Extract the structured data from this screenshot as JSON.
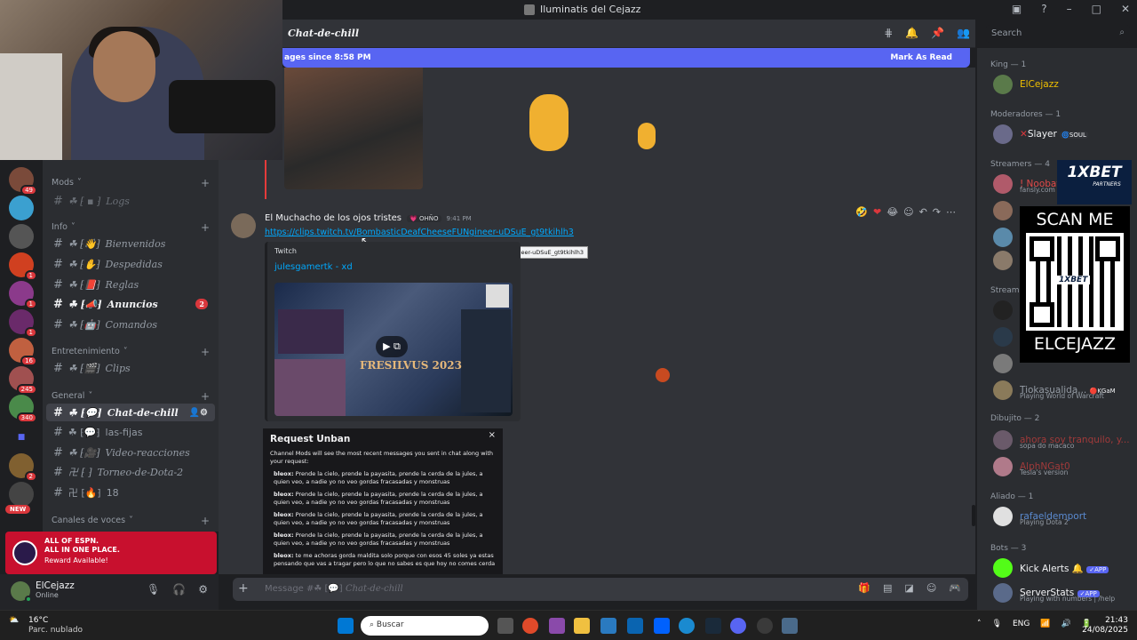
{
  "window": {
    "title": "Iluminatis del Cejazz"
  },
  "header": {
    "channel": "Chat-de-chill",
    "search_placeholder": "Search"
  },
  "new_messages": {
    "text": "ages since 8:58 PM",
    "mark_read": "Mark As Read"
  },
  "servers": {
    "badges": [
      "49",
      "1",
      "1",
      "1",
      "16",
      "245",
      "340",
      "2",
      "NEW"
    ]
  },
  "channels": {
    "categories": {
      "mods": "Mods",
      "info": "Info",
      "entretenimiento": "Entretenimiento",
      "general": "General",
      "voces": "Canales de voces"
    },
    "items": [
      {
        "label": "Logs"
      },
      {
        "label": "Bienvenidos"
      },
      {
        "label": "Despedidas"
      },
      {
        "label": "Reglas"
      },
      {
        "label": "Anuncios",
        "badge": "2"
      },
      {
        "label": "Comandos"
      },
      {
        "label": "Clips"
      },
      {
        "label": "Chat-de-chill"
      },
      {
        "label": "las-fijas"
      },
      {
        "label": "Video-reacciones"
      },
      {
        "label": "Torneo-de-Dota-2"
      },
      {
        "label": "18"
      }
    ]
  },
  "promo": {
    "line1": "ALL OF ESPN.",
    "line2": "ALL IN ONE PLACE.",
    "line3": "Reward Available!"
  },
  "user": {
    "name": "ElCejazz",
    "status": "Online"
  },
  "message": {
    "author": "El Muchacho de los ojos tristes",
    "tag": "OHÑO",
    "time": "9:41 PM",
    "link": "https://clips.twitch.tv/BombasticDeafCheeseFUNgineer-uDSuE_gt9tkihlh3",
    "tooltip": "https://clips.twitch.tv/BombasticDeafCheeseFUNgineer-uDSuE_gt9tkihlh3",
    "embed_provider": "Twitch",
    "embed_title": "julesgamertk - xd",
    "thumb_title": "FRESILVUS 2023"
  },
  "unban": {
    "title": "Request Unban",
    "desc": "Channel Mods will see the most recent messages you sent in chat along with your request:",
    "msgs": [
      {
        "user": "bleox:",
        "text": "Prende la cielo, prende la payasita, prende la cerda de la jules, a quien veo, a nadie yo no veo gordas fracasadas y monstruas"
      },
      {
        "user": "bleox:",
        "text": "Prende la cielo, prende la payasita, prende la cerda de la jules, a quien veo, a nadie yo no veo gordas fracasadas y monstruas"
      },
      {
        "user": "bleox:",
        "text": "Prende la cielo, prende la payasita, prende la cerda de la jules, a quien veo, a nadie yo no veo gordas fracasadas y monstruas"
      },
      {
        "user": "bleox:",
        "text": "Prende la cielo, prende la payasita, prende la cerda de la jules, a quien veo, a nadie yo no veo gordas fracasadas y monstruas"
      },
      {
        "user": "bleox:",
        "text": "te me achoras gorda maldita solo porque con esos 45 soles ya estas pensando que vas a tragar pero lo que no sabes es que hoy no comes cerda"
      }
    ]
  },
  "members": {
    "king": "King — 1",
    "moderadores": "Moderadores — 1",
    "streamers": "Streamers — 4",
    "streamers2": "Streame",
    "dibujito": "Dibujito — 2",
    "aliado": "Aliado — 1",
    "bots": "Bots — 3",
    "list": [
      {
        "name": "ElCejazz"
      },
      {
        "name": "Slayer",
        "tag": "SOUL"
      },
      {
        "name": "! Noobat",
        "sub": "fansly.com"
      },
      {
        "name": "Tiokasualida...",
        "tag": "KGaM",
        "sub": "Playing World of Warcraft"
      },
      {
        "name": "ahora soy tranquilo, y...",
        "sub": "sopa do macaco"
      },
      {
        "name": "AlphNGat0",
        "sub": "Tesla's version"
      },
      {
        "name": "rafaeldemport",
        "sub": "Playing Dota 2"
      },
      {
        "name": "Kick Alerts",
        "tag": "APP"
      },
      {
        "name": "ServerStats",
        "tag": "APP",
        "sub": "Playing with numbers | /help"
      }
    ]
  },
  "ads": {
    "brand": "1XBET",
    "partners": "PARTNERS",
    "scan": "SCAN ME",
    "qr_label": "1XBET",
    "handle": "ELCEJAZZ"
  },
  "composer": {
    "placeholder": "Message #",
    "channel": "Chat-de-chill"
  },
  "taskbar": {
    "temp": "16°C",
    "weather": "Parc. nublado",
    "search": "Buscar",
    "lang": "ENG",
    "time": "21:43",
    "date": "24/08/2025"
  },
  "colors": {
    "blurple": "#5865f2",
    "link": "#00a8fc",
    "green": "#23a55a",
    "red": "#da373c"
  }
}
